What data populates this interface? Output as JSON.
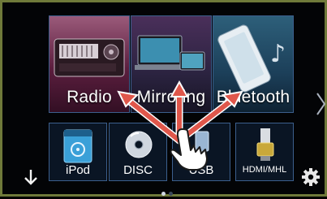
{
  "main_sources": [
    {
      "id": "radio",
      "label": "Radio"
    },
    {
      "id": "mirroring",
      "label": "Mirroring"
    },
    {
      "id": "bluetooth",
      "label": "Bluetooth"
    }
  ],
  "sources": [
    {
      "id": "ipod",
      "label": "iPod",
      "icon": "ipod-icon"
    },
    {
      "id": "disc",
      "label": "DISC",
      "icon": "disc-icon"
    },
    {
      "id": "usb",
      "label": "USB",
      "icon": "usb-icon"
    },
    {
      "id": "hdmi",
      "label": "HDMI/MHL",
      "icon": "hdmi-icon"
    }
  ],
  "navigation": {
    "down_icon": "arrow-down-icon",
    "next_icon": "chevron-right-icon",
    "settings_icon": "gear-icon"
  },
  "pagination": {
    "current_page": 1,
    "total_pages": 2
  },
  "gesture": {
    "type": "swipe-up",
    "icon": "hand-pointer-icon",
    "arrow_color": "#e0574b"
  },
  "colors": {
    "frame": "#6f7a3a",
    "tile_border": "#3c5f8d",
    "background": "#030406"
  }
}
